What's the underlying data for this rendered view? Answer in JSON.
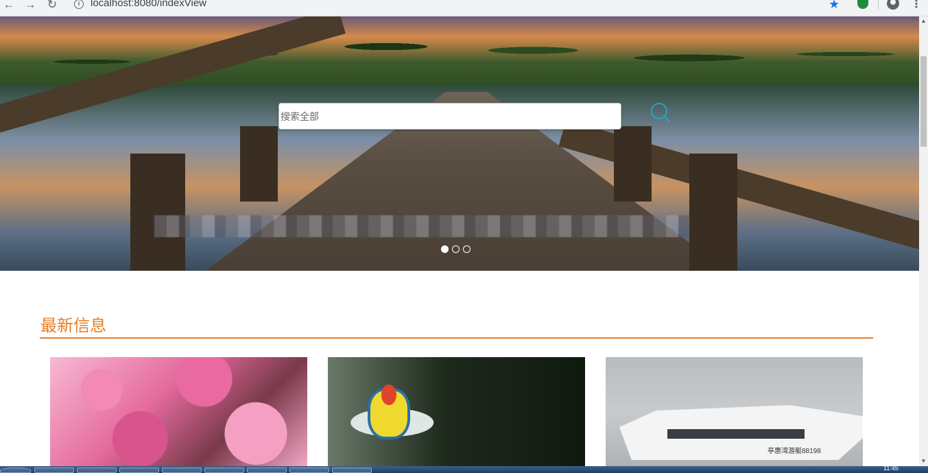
{
  "browser": {
    "url": "localhost:8080/indexView",
    "back_icon": "←",
    "forward_icon": "→",
    "reload_icon": "↻",
    "info_icon": "i",
    "star_icon": "★",
    "menu_icon": "⋮"
  },
  "hero": {
    "search": {
      "placeholder": "搜索全部",
      "value": ""
    },
    "carousel_slide_count": 3,
    "carousel_active": 1
  },
  "news": {
    "title": "最新信息",
    "accent_color": "#e87e22",
    "cards": [
      {
        "image": "cherry-blossom"
      },
      {
        "image": "river-rafting"
      },
      {
        "image": "yacht",
        "boat_text": "亭惠湾游艇88198"
      }
    ]
  },
  "taskbar": {
    "clock": "11:45"
  }
}
